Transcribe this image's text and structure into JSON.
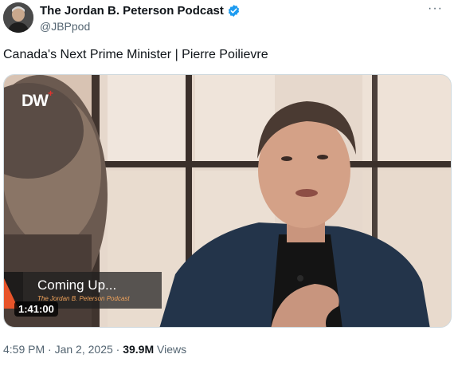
{
  "author": {
    "name": "The Jordan B. Peterson Podcast",
    "handle": "@JBPpod",
    "verified": true,
    "avatar_icon": "avatar-portrait"
  },
  "more_icon": "···",
  "tweet": {
    "text": "Canada's Next Prime Minister | Pierre Poilievre"
  },
  "video": {
    "logo_text": "DW",
    "logo_mark": "+",
    "overlay_title": "Coming Up...",
    "overlay_subtitle": "The Jordan B. Peterson Podcast",
    "duration": "1:41:00"
  },
  "meta": {
    "time": "4:59 PM",
    "separator": "·",
    "date": "Jan 2, 2025",
    "views_count": "39.9M",
    "views_label": "Views"
  },
  "colors": {
    "verified": "#1d9bf0",
    "overlay_accent": "#e8542a",
    "secondary_text": "#536471"
  }
}
